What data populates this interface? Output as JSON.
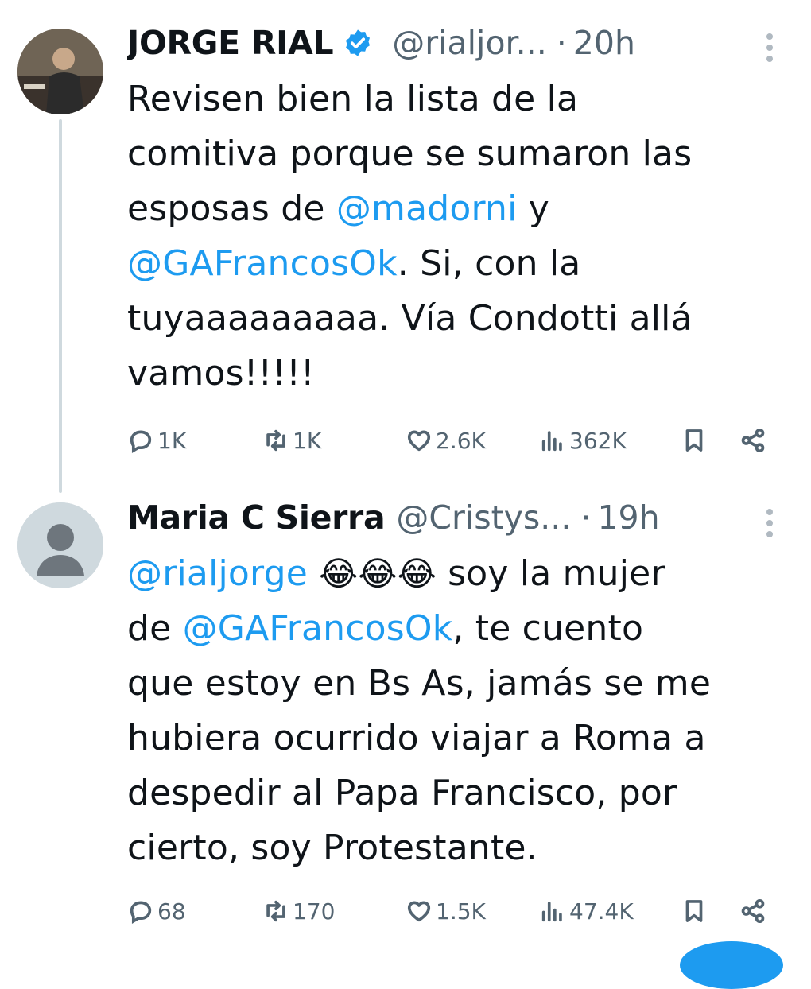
{
  "tweets": [
    {
      "name": "JORGE RIAL",
      "verified": true,
      "handle": "@rialjor...",
      "dot": "·",
      "time": "20h",
      "lines": [
        [
          {
            "t": "Revisen bien la lista de la"
          }
        ],
        [
          {
            "t": "comitiva porque se sumaron las"
          }
        ],
        [
          {
            "t": "esposas de "
          },
          {
            "t": "@madorni",
            "m": true
          },
          {
            "t": " y"
          }
        ],
        [
          {
            "t": "@GAFrancosOk",
            "m": true
          },
          {
            "t": ". Si, con la"
          }
        ],
        [
          {
            "t": "tuyaaaaaaaaa. Vía Condotti allá"
          }
        ],
        [
          {
            "t": "vamos!!!!!"
          }
        ]
      ],
      "stats": {
        "replies": "1K",
        "reposts": "1K",
        "likes": "2.6K",
        "views": "362K"
      }
    },
    {
      "name": "Maria C Sierra",
      "verified": false,
      "handle": "@Cristys...",
      "dot": "·",
      "time": "19h",
      "lines": [
        [
          {
            "t": "@rialjorge",
            "m": true
          },
          {
            "t": " "
          },
          {
            "t": "😂😂😂",
            "e": true
          },
          {
            "t": " soy la mujer"
          }
        ],
        [
          {
            "t": "de "
          },
          {
            "t": "@GAFrancosOk",
            "m": true
          },
          {
            "t": ", te cuento"
          }
        ],
        [
          {
            "t": "que estoy en Bs As, jamás se me"
          }
        ],
        [
          {
            "t": "hubiera ocurrido viajar a Roma a"
          }
        ],
        [
          {
            "t": "despedir al Papa Francisco, por"
          }
        ],
        [
          {
            "t": "cierto, soy Protestante."
          }
        ]
      ],
      "stats": {
        "replies": "68",
        "reposts": "170",
        "likes": "1.5K",
        "views": "47.4K"
      }
    }
  ],
  "icons": {
    "reply": "reply-icon",
    "repost": "repost-icon",
    "like": "heart-icon",
    "views": "views-icon",
    "bookmark": "bookmark-icon",
    "share": "share-icon",
    "more": "more-options-icon",
    "verified": "verified-badge-icon"
  },
  "colors": {
    "mention": "#1d9bf0",
    "secondary": "#536471",
    "verified": "#1d9bf0",
    "thread": "#cfd9de"
  }
}
